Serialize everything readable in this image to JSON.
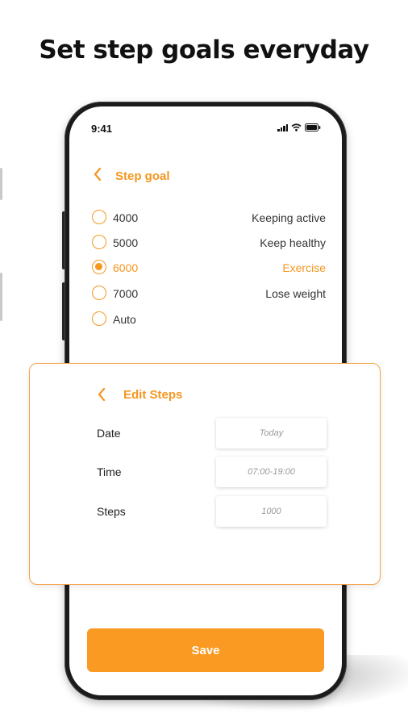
{
  "headline": "Set step goals everyday",
  "status_bar": {
    "time": "9:41"
  },
  "step_goal_screen": {
    "title": "Step goal",
    "goals": [
      {
        "value": "4000",
        "description": "Keeping active",
        "selected": false
      },
      {
        "value": "5000",
        "description": "Keep healthy",
        "selected": false
      },
      {
        "value": "6000",
        "description": "Exercise",
        "selected": true
      },
      {
        "value": "7000",
        "description": "Lose weight",
        "selected": false
      },
      {
        "value": "Auto",
        "description": "",
        "selected": false
      }
    ],
    "save_label": "Save"
  },
  "edit_steps": {
    "title": "Edit Steps",
    "fields": [
      {
        "label": "Date",
        "placeholder": "Today"
      },
      {
        "label": "Time",
        "placeholder": "07:00-19:00"
      },
      {
        "label": "Steps",
        "placeholder": "1000"
      }
    ]
  },
  "colors": {
    "accent": "#f5961e",
    "button": "#fb9a22",
    "text": "#222222"
  },
  "icons": [
    "chevron-left-icon",
    "signal-icon",
    "wifi-icon",
    "battery-icon"
  ]
}
